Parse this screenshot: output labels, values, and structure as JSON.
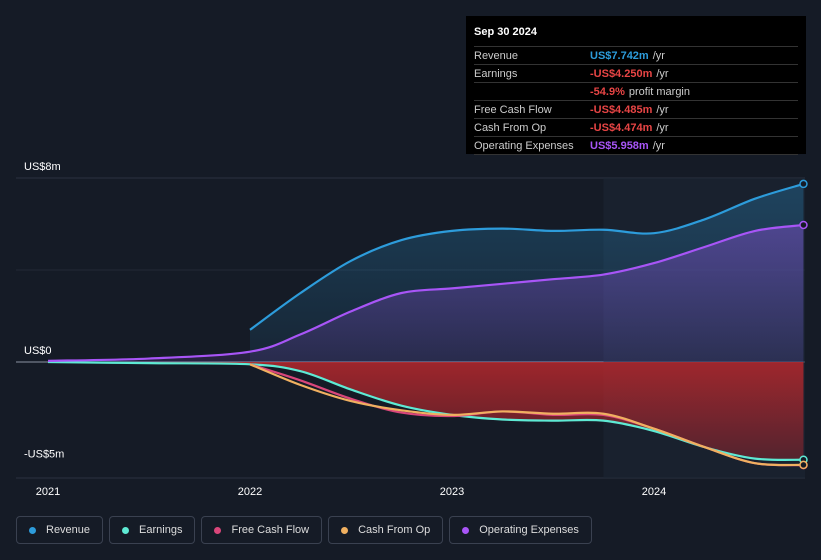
{
  "tooltip": {
    "date": "Sep 30 2024",
    "rows": [
      {
        "label": "Revenue",
        "value": "US$7.742m",
        "unit": "/yr",
        "color": "#2d9cdb"
      },
      {
        "label": "Earnings",
        "value": "-US$4.250m",
        "unit": "/yr",
        "color": "#e84545"
      },
      {
        "label": "",
        "value": "-54.9%",
        "unit": "profit margin",
        "color": "#e84545"
      },
      {
        "label": "Free Cash Flow",
        "value": "-US$4.485m",
        "unit": "/yr",
        "color": "#e84545"
      },
      {
        "label": "Cash From Op",
        "value": "-US$4.474m",
        "unit": "/yr",
        "color": "#e84545"
      },
      {
        "label": "Operating Expenses",
        "value": "US$5.958m",
        "unit": "/yr",
        "color": "#a855f7"
      }
    ]
  },
  "legend": [
    {
      "label": "Revenue",
      "color": "#2d9cdb"
    },
    {
      "label": "Earnings",
      "color": "#5eead4"
    },
    {
      "label": "Free Cash Flow",
      "color": "#d9467a"
    },
    {
      "label": "Cash From Op",
      "color": "#f0b060"
    },
    {
      "label": "Operating Expenses",
      "color": "#a855f7"
    }
  ],
  "chart_data": {
    "type": "area",
    "title": "",
    "xlabel": "",
    "ylabel": "",
    "ylim": [
      -5,
      8
    ],
    "xlim": [
      2020.99,
      2024.75
    ],
    "y_tick_labels": [
      {
        "value": 8,
        "label": "US$8m"
      },
      {
        "value": 0,
        "label": "US$0"
      },
      {
        "value": -4.5,
        "label": "-US$5m"
      }
    ],
    "x_tick_labels": [
      {
        "value": 2021,
        "label": "2021"
      },
      {
        "value": 2022,
        "label": "2022"
      },
      {
        "value": 2023,
        "label": "2023"
      },
      {
        "value": 2024,
        "label": "2024"
      }
    ],
    "highlight_from": 2023.75,
    "series": [
      {
        "name": "Revenue",
        "color": "#2d9cdb",
        "x": [
          2022.0,
          2022.25,
          2022.5,
          2022.75,
          2023.0,
          2023.25,
          2023.5,
          2023.75,
          2024.0,
          2024.25,
          2024.5,
          2024.74
        ],
        "y": [
          1.4,
          3.0,
          4.4,
          5.3,
          5.7,
          5.8,
          5.7,
          5.75,
          5.6,
          6.2,
          7.1,
          7.742
        ]
      },
      {
        "name": "Earnings",
        "color": "#5eead4",
        "x": [
          2021.0,
          2021.5,
          2022.0,
          2022.25,
          2022.5,
          2022.75,
          2023.0,
          2023.25,
          2023.5,
          2023.75,
          2024.0,
          2024.25,
          2024.5,
          2024.74
        ],
        "y": [
          0.0,
          -0.05,
          -0.1,
          -0.4,
          -1.2,
          -1.9,
          -2.3,
          -2.5,
          -2.55,
          -2.55,
          -3.0,
          -3.7,
          -4.2,
          -4.25
        ]
      },
      {
        "name": "Free Cash Flow",
        "color": "#d9467a",
        "x": [
          2022.0,
          2022.25,
          2022.5,
          2022.75,
          2023.0,
          2023.25,
          2023.5,
          2023.75,
          2024.0,
          2024.25,
          2024.5,
          2024.74
        ],
        "y": [
          -0.1,
          -0.8,
          -1.6,
          -2.2,
          -2.35,
          -2.15,
          -2.3,
          -2.3,
          -2.9,
          -3.7,
          -4.4,
          -4.485
        ]
      },
      {
        "name": "Cash From Op",
        "color": "#f0b060",
        "x": [
          2022.0,
          2022.25,
          2022.5,
          2022.75,
          2023.0,
          2023.25,
          2023.5,
          2023.75,
          2024.0,
          2024.25,
          2024.5,
          2024.74
        ],
        "y": [
          -0.1,
          -1.0,
          -1.7,
          -2.1,
          -2.3,
          -2.15,
          -2.25,
          -2.25,
          -2.9,
          -3.7,
          -4.4,
          -4.474
        ]
      },
      {
        "name": "Operating Expenses",
        "color": "#a855f7",
        "x": [
          2021.0,
          2021.5,
          2022.0,
          2022.25,
          2022.5,
          2022.75,
          2023.0,
          2023.25,
          2023.5,
          2023.75,
          2024.0,
          2024.25,
          2024.5,
          2024.74
        ],
        "y": [
          0.05,
          0.15,
          0.45,
          1.2,
          2.2,
          3.0,
          3.2,
          3.4,
          3.6,
          3.8,
          4.3,
          5.0,
          5.7,
          5.958
        ]
      }
    ]
  }
}
